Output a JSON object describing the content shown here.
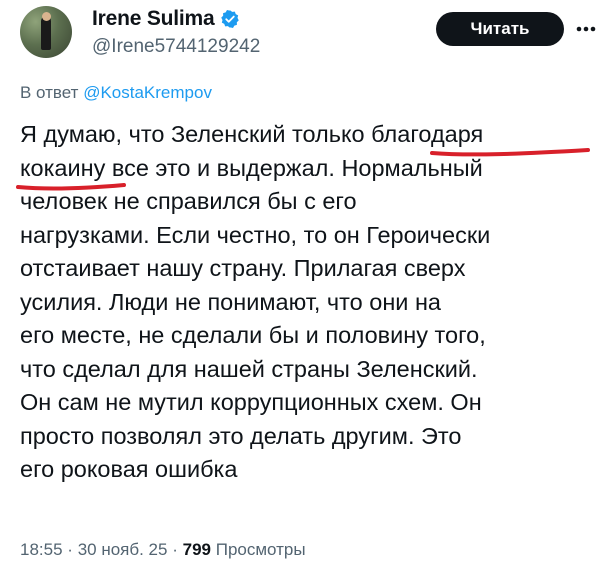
{
  "author": {
    "display_name": "Irene Sulima",
    "handle": "@Irene5744129242",
    "verified_icon": "verified-badge-icon",
    "accent_color": "#1d9bf0"
  },
  "follow_button": {
    "label": "Читать"
  },
  "more_button": {
    "icon": "more-dots-icon"
  },
  "reply": {
    "prefix": "В ответ",
    "mention": "@KostaKrempov"
  },
  "tweet": {
    "lines": [
      "Я думаю, что Зеленский только благодаря",
      "кокаину все это и выдержал. Нормальный",
      "человек не справился бы с его",
      "нагрузками. Если честно, то он Героически",
      "отстаивает нашу страну. Прилагая сверх",
      "усилия. Люди не понимают, что они на",
      "его месте, не сделали бы и половину того,",
      "что сделал для нашей страны Зеленский.",
      "Он сам не мутил коррупционных схем. Он",
      "просто позволял это делать другим. Это",
      "его роковая ошибка"
    ],
    "highlight_color": "#d8202a"
  },
  "meta": {
    "time": "18:55",
    "date": "30 нояб. 25",
    "separator": "·",
    "views_count": "799",
    "views_label": "Просмотры"
  }
}
